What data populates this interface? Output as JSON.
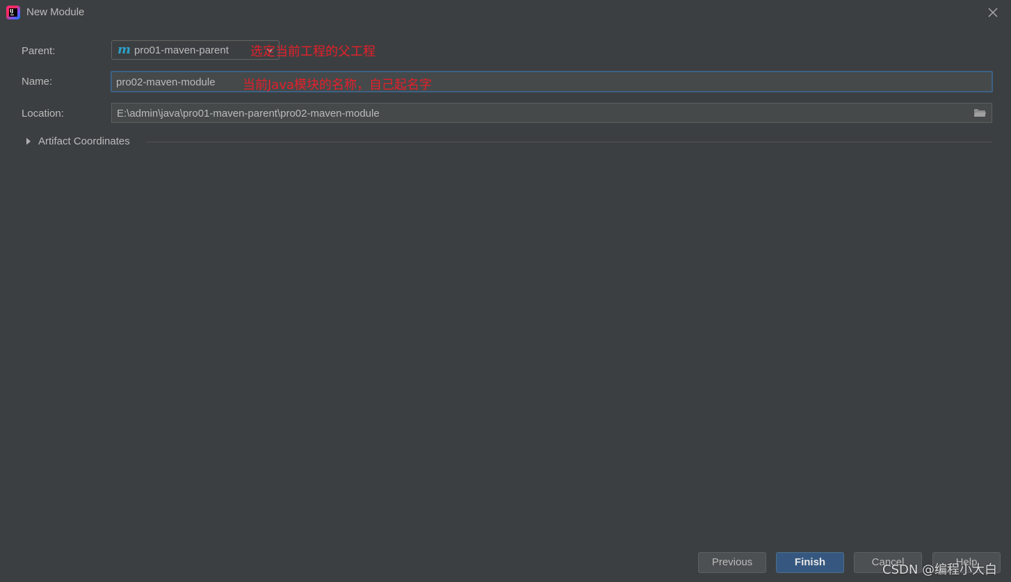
{
  "window": {
    "title": "New Module",
    "app_icon": "intellij-idea-icon",
    "close_icon": "close-icon"
  },
  "form": {
    "parent": {
      "label": "Parent:",
      "value": "pro01-maven-parent",
      "icon": "maven-icon",
      "icon_glyph": "m",
      "annotation": "选定当前工程的父工程"
    },
    "name": {
      "label": "Name:",
      "value": "pro02-maven-module",
      "annotation": "当前Java模块的名称，自己起名字"
    },
    "location": {
      "label": "Location:",
      "value": "E:\\admin\\java\\pro01-maven-parent\\pro02-maven-module",
      "icon": "folder-icon"
    },
    "artifact_coordinates": {
      "label": "Artifact Coordinates",
      "expanded": false
    }
  },
  "buttons": {
    "previous": "Previous",
    "finish": "Finish",
    "cancel": "Cancel",
    "help": "Help"
  },
  "watermark": "CSDN @编程小大白",
  "colors": {
    "background": "#3c3f41",
    "text": "#bbbbbb",
    "annotation": "#e5202b",
    "focus_border": "#3d6185",
    "primary_button": "#365880",
    "maven_icon": "#2ba1c9"
  }
}
